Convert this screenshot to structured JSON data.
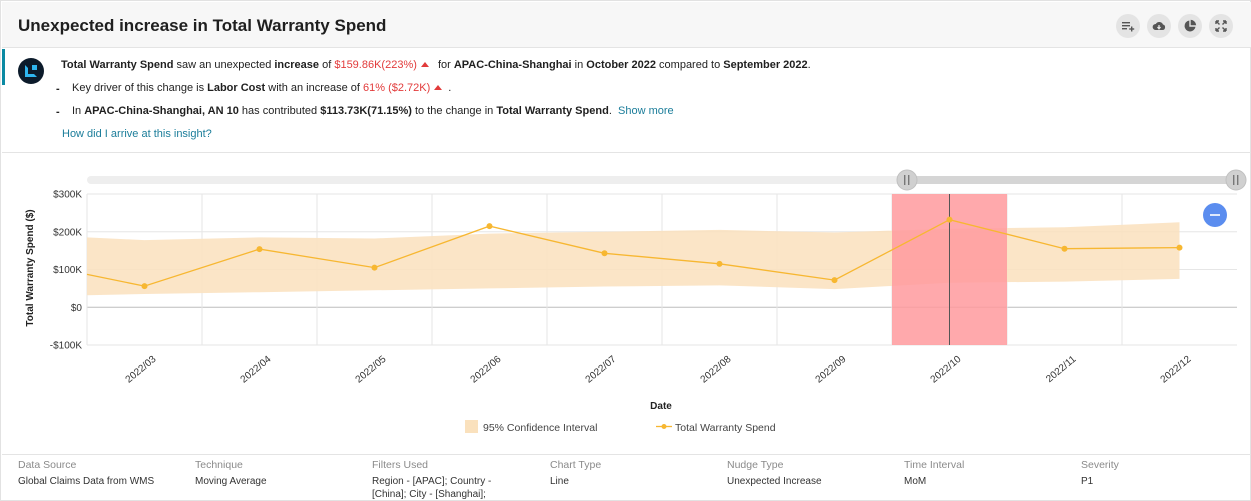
{
  "header": {
    "title": "Unexpected increase in Total Warranty Spend",
    "icons": [
      "add-to-list-icon",
      "cloud-download-icon",
      "pie-chart-icon",
      "fullscreen-icon"
    ]
  },
  "insight": {
    "line1": {
      "metric": "Total Warranty Spend",
      "text_a": " saw an unexpected ",
      "direction": "increase",
      "text_b": " of ",
      "change": "$159.86K(223%)",
      "text_c": " for ",
      "entity": "APAC-China-Shanghai",
      "text_d": " in ",
      "period": "October 2022",
      "text_e": " compared to ",
      "prev_period": "September 2022",
      "text_f": "."
    },
    "line2": {
      "bullet": "-",
      "text_a": "Key driver of this change is ",
      "driver": "Labor Cost",
      "text_b": " with an increase of ",
      "change": "61% ($2.72K)",
      "text_c": "."
    },
    "line3": {
      "bullet": "-",
      "text_a": "In ",
      "entity": "APAC-China-Shanghai, AN 10",
      "text_b": " has contributed ",
      "amount": "$113.73K(71.15%)",
      "text_c": " to the change in ",
      "metric": "Total Warranty Spend",
      "text_d": ".",
      "show_more": "Show more"
    },
    "how_link": "How did I arrive at this insight?"
  },
  "chart_data": {
    "type": "line",
    "xlabel": "Date",
    "ylabel": "Total Warranty Spend ($)",
    "y_ticks": [
      "$300K",
      "$200K",
      "$100K",
      "$0",
      "-$100K"
    ],
    "ylim": [
      -100,
      300
    ],
    "y_unit": "K",
    "categories": [
      "2022/03",
      "2022/04",
      "2022/05",
      "2022/06",
      "2022/07",
      "2022/08",
      "2022/09",
      "2022/10",
      "2022/11",
      "2022/12"
    ],
    "x_series": [
      2.5,
      3,
      4,
      5,
      6,
      7,
      8,
      9,
      10,
      11,
      12
    ],
    "series": [
      {
        "name": "Total Warranty Spend",
        "color": "#f7b731",
        "values": [
          87,
          56,
          154,
          105,
          215,
          143,
          115,
          72,
          232,
          155,
          158
        ]
      }
    ],
    "confidence_interval": {
      "name": "95% Confidence Interval",
      "color": "#fae1bd",
      "upper": [
        185,
        178,
        185,
        182,
        195,
        200,
        205,
        198,
        208,
        212,
        225
      ],
      "lower": [
        32,
        35,
        40,
        45,
        50,
        55,
        58,
        48,
        65,
        68,
        75
      ]
    },
    "highlight": {
      "category": "2022/10",
      "color": "#ff9a9e"
    },
    "legend": [
      "95% Confidence Interval",
      "Total Warranty Spend"
    ],
    "legend_position": "bottom",
    "grid": true
  },
  "footer": [
    {
      "label": "Data Source",
      "value": "Global Claims Data from WMS"
    },
    {
      "label": "Technique",
      "value": "Moving Average"
    },
    {
      "label": "Filters Used",
      "value": "Region - [APAC]; Country - [China]; City - [Shanghai];"
    },
    {
      "label": "Chart Type",
      "value": "Line"
    },
    {
      "label": "Nudge Type",
      "value": "Unexpected Increase"
    },
    {
      "label": "Time Interval",
      "value": "MoM"
    },
    {
      "label": "Severity",
      "value": "P1"
    }
  ]
}
